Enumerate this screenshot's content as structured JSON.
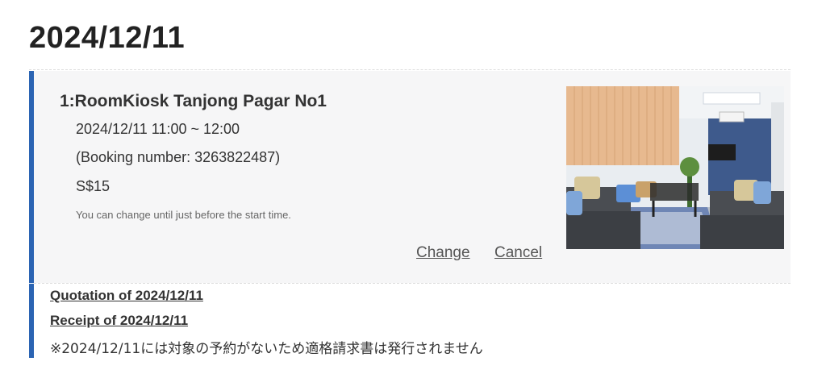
{
  "date_heading": "2024/12/11",
  "booking": {
    "room_name": "1:RoomKiosk Tanjong Pagar No1",
    "time": "2024/12/11 11:00 ~ 12:00",
    "booking_number": "(Booking number: 3263822487)",
    "price": "S$15",
    "note": "You can change until just before the start time.",
    "change_label": "Change",
    "cancel_label": "Cancel"
  },
  "documents": {
    "quotation_label": "Quotation of 2024/12/11",
    "receipt_label": "Receipt of 2024/12/11",
    "invoice_note": "※2024/12/11には対象の予約がないため適格請求書は発行されません"
  },
  "colors": {
    "accent": "#2b64b3",
    "card_bg": "#f6f6f7"
  }
}
